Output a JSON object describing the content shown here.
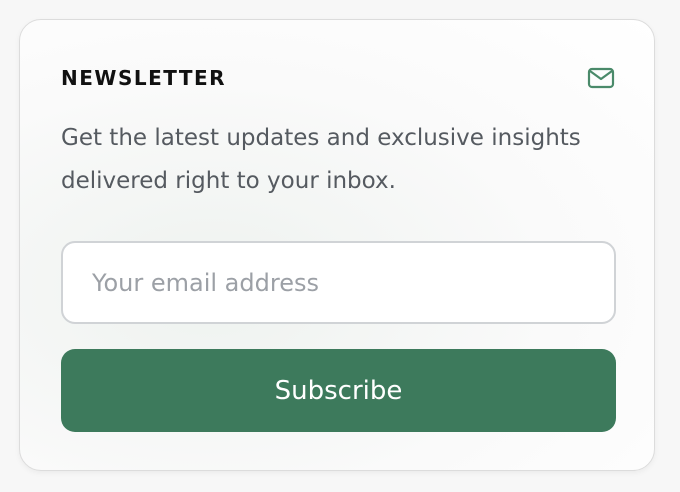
{
  "newsletter": {
    "title": "NEWSLETTER",
    "icon": "mail-icon",
    "description": "Get the latest updates and exclusive insights delivered right to your inbox.",
    "email_placeholder": "Your email address",
    "email_value": "",
    "subscribe_label": "Subscribe"
  },
  "colors": {
    "accent": "#3d7a5c",
    "icon": "#4a8a6a",
    "text": "#555a60"
  }
}
